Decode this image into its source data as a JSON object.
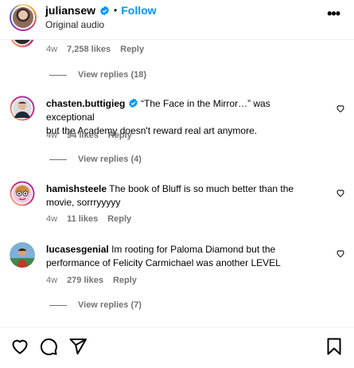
{
  "header": {
    "username": "juliansew",
    "dot": "•",
    "follow_label": "Follow",
    "subtitle": "Original audio",
    "more_label": "•••"
  },
  "comments": [
    {
      "time": "4w",
      "likes": "7,258 likes",
      "reply_label": "Reply",
      "view_replies": "View replies (18)"
    },
    {
      "username": "chasten.buttigieg",
      "verified": true,
      "text_line1": "“The Face in the Mirror…” was exceptional",
      "text_line2": "but the Academy doesn't reward real art anymore.",
      "time": "4w",
      "likes": "94 likes",
      "reply_label": "Reply",
      "view_replies": "View replies (4)"
    },
    {
      "username": "hamishsteele",
      "text_line1": "The book of Bluff is so much better than the",
      "text_line2": "movie, sorrryyyyy",
      "time": "4w",
      "likes": "11 likes",
      "reply_label": "Reply"
    },
    {
      "username": "lucasesgenial",
      "text_line1": "Im rooting for Paloma Diamond but the",
      "text_line2": "performance of Felicity Carmichael was another LEVEL",
      "time": "4w",
      "likes": "279 likes",
      "reply_label": "Reply",
      "view_replies": "View replies (7)"
    }
  ],
  "icons": {
    "like": "heart-icon",
    "comment": "comment-icon",
    "share": "send-icon",
    "save": "bookmark-icon"
  },
  "colors": {
    "accent": "#0095f6",
    "muted": "#737373"
  }
}
